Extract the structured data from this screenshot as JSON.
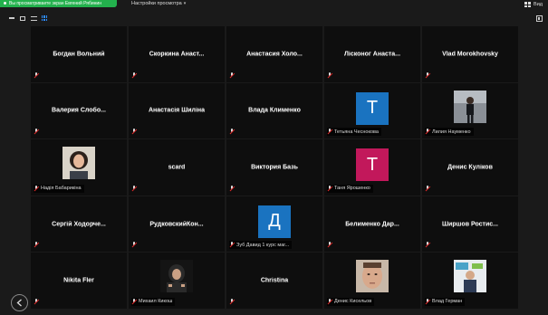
{
  "banner": {
    "text": "Вы просматриваете экран Евгений Рябинин"
  },
  "view_settings": {
    "label": "Настройки просмотра"
  },
  "view_button": {
    "label": "Вид"
  },
  "colors": {
    "banner_green": "#23b14d",
    "avatar_blue": "#1a73c0",
    "avatar_pink": "#c2185b",
    "tile_bg": "#0e0e0e",
    "mic_muted": "#e02828"
  },
  "participants": [
    {
      "name": "Богдан Вольний",
      "caption": ""
    },
    {
      "name": "Скоркина Анаст...",
      "caption": ""
    },
    {
      "name": "Анастасия Холо...",
      "caption": ""
    },
    {
      "name": "Лісконог Анаста...",
      "caption": ""
    },
    {
      "name": "Vlad Morokhovsky",
      "caption": ""
    },
    {
      "name": "Валерия Слобо...",
      "caption": ""
    },
    {
      "name": "Анастасія Шиліна",
      "caption": ""
    },
    {
      "name": "Влада Клименко",
      "caption": ""
    },
    {
      "name": "",
      "caption": "Тетьяна Чеснокова",
      "avatar": "T"
    },
    {
      "name": "",
      "caption": "Лилия Науменко",
      "photo": "person-standing"
    },
    {
      "name": "",
      "caption": "Надія Бабарикіна",
      "photo": "woman-curly"
    },
    {
      "name": "scard",
      "caption": ""
    },
    {
      "name": "Виктория Базь",
      "caption": ""
    },
    {
      "name": "",
      "caption": "Таня Ярошенко",
      "avatar": "T"
    },
    {
      "name": "Денис Куліков",
      "caption": ""
    },
    {
      "name": "Сергій Ходорче...",
      "caption": ""
    },
    {
      "name": "РудковскийКон...",
      "caption": ""
    },
    {
      "name": "",
      "caption": "Зуб Давид 1 курс маг...",
      "avatar": "Д"
    },
    {
      "name": "Белименко Дар...",
      "caption": ""
    },
    {
      "name": "Ширшов Ростис...",
      "caption": ""
    },
    {
      "name": "Nikita Fler",
      "caption": ""
    },
    {
      "name": "",
      "caption": "Михаил Кикош",
      "photo": "man-hoodie"
    },
    {
      "name": "Christina",
      "caption": ""
    },
    {
      "name": "",
      "caption": "Денис Кисельов",
      "photo": "man-face"
    },
    {
      "name": "",
      "caption": "Влад Герман",
      "photo": "man-office"
    }
  ]
}
